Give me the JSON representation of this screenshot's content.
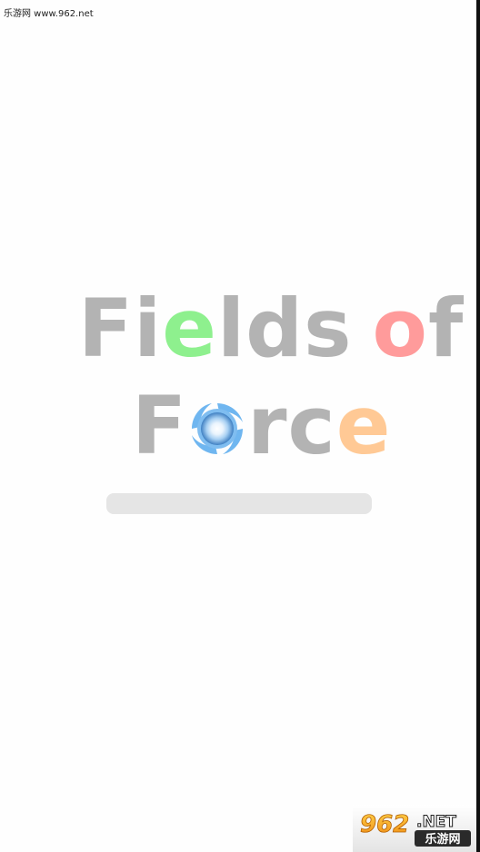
{
  "watermark_top": "乐游网 www.962.net",
  "title": {
    "line1": {
      "F": "F",
      "i": "i",
      "e": "e",
      "lds": "lds",
      "o": "o",
      "f": "f"
    },
    "line2": {
      "F": "F",
      "rc": "rc",
      "e": "e"
    }
  },
  "loading": {
    "progress": 0
  },
  "logo_badge": {
    "number": "962",
    "suffix": ".NET",
    "name": "乐游网"
  },
  "colors": {
    "gray": "#b3b3b3",
    "green": "#8ef08e",
    "red": "#ff9b9b",
    "peach": "#ffc995",
    "orb_blue": "#6fb6f0"
  },
  "icons": {
    "orb": "energy-orb-icon"
  }
}
